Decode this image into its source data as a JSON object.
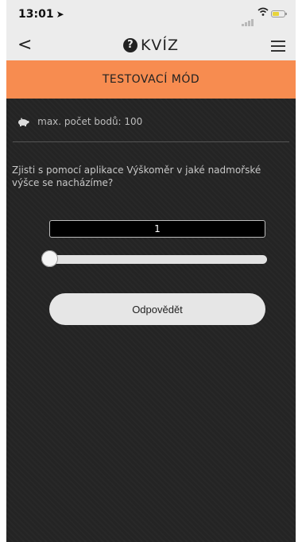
{
  "status_bar": {
    "time": "13:01",
    "location_icon": "location-arrow-icon",
    "signal_icon": "signal-icon",
    "wifi_icon": "wifi-icon",
    "battery_icon": "battery-icon",
    "battery_color": "#e8d43a"
  },
  "nav": {
    "back_symbol": "<",
    "help_symbol": "?",
    "title": "KVÍZ",
    "menu_icon": "hamburger-menu-icon"
  },
  "banner": {
    "text": "TESTOVACÍ MÓD",
    "color": "#f78c50"
  },
  "quiz": {
    "points_label": "max. počet bodů: 100",
    "question": "Zjisti s pomocí aplikace Výškoměr v jaké nadmořské výšce se nacházíme?",
    "value": "1",
    "slider_fraction": 0,
    "answer_button": "Odpovědět"
  },
  "colors": {
    "accent": "#f78c50",
    "background": "#242424",
    "bar": "#ececec"
  }
}
